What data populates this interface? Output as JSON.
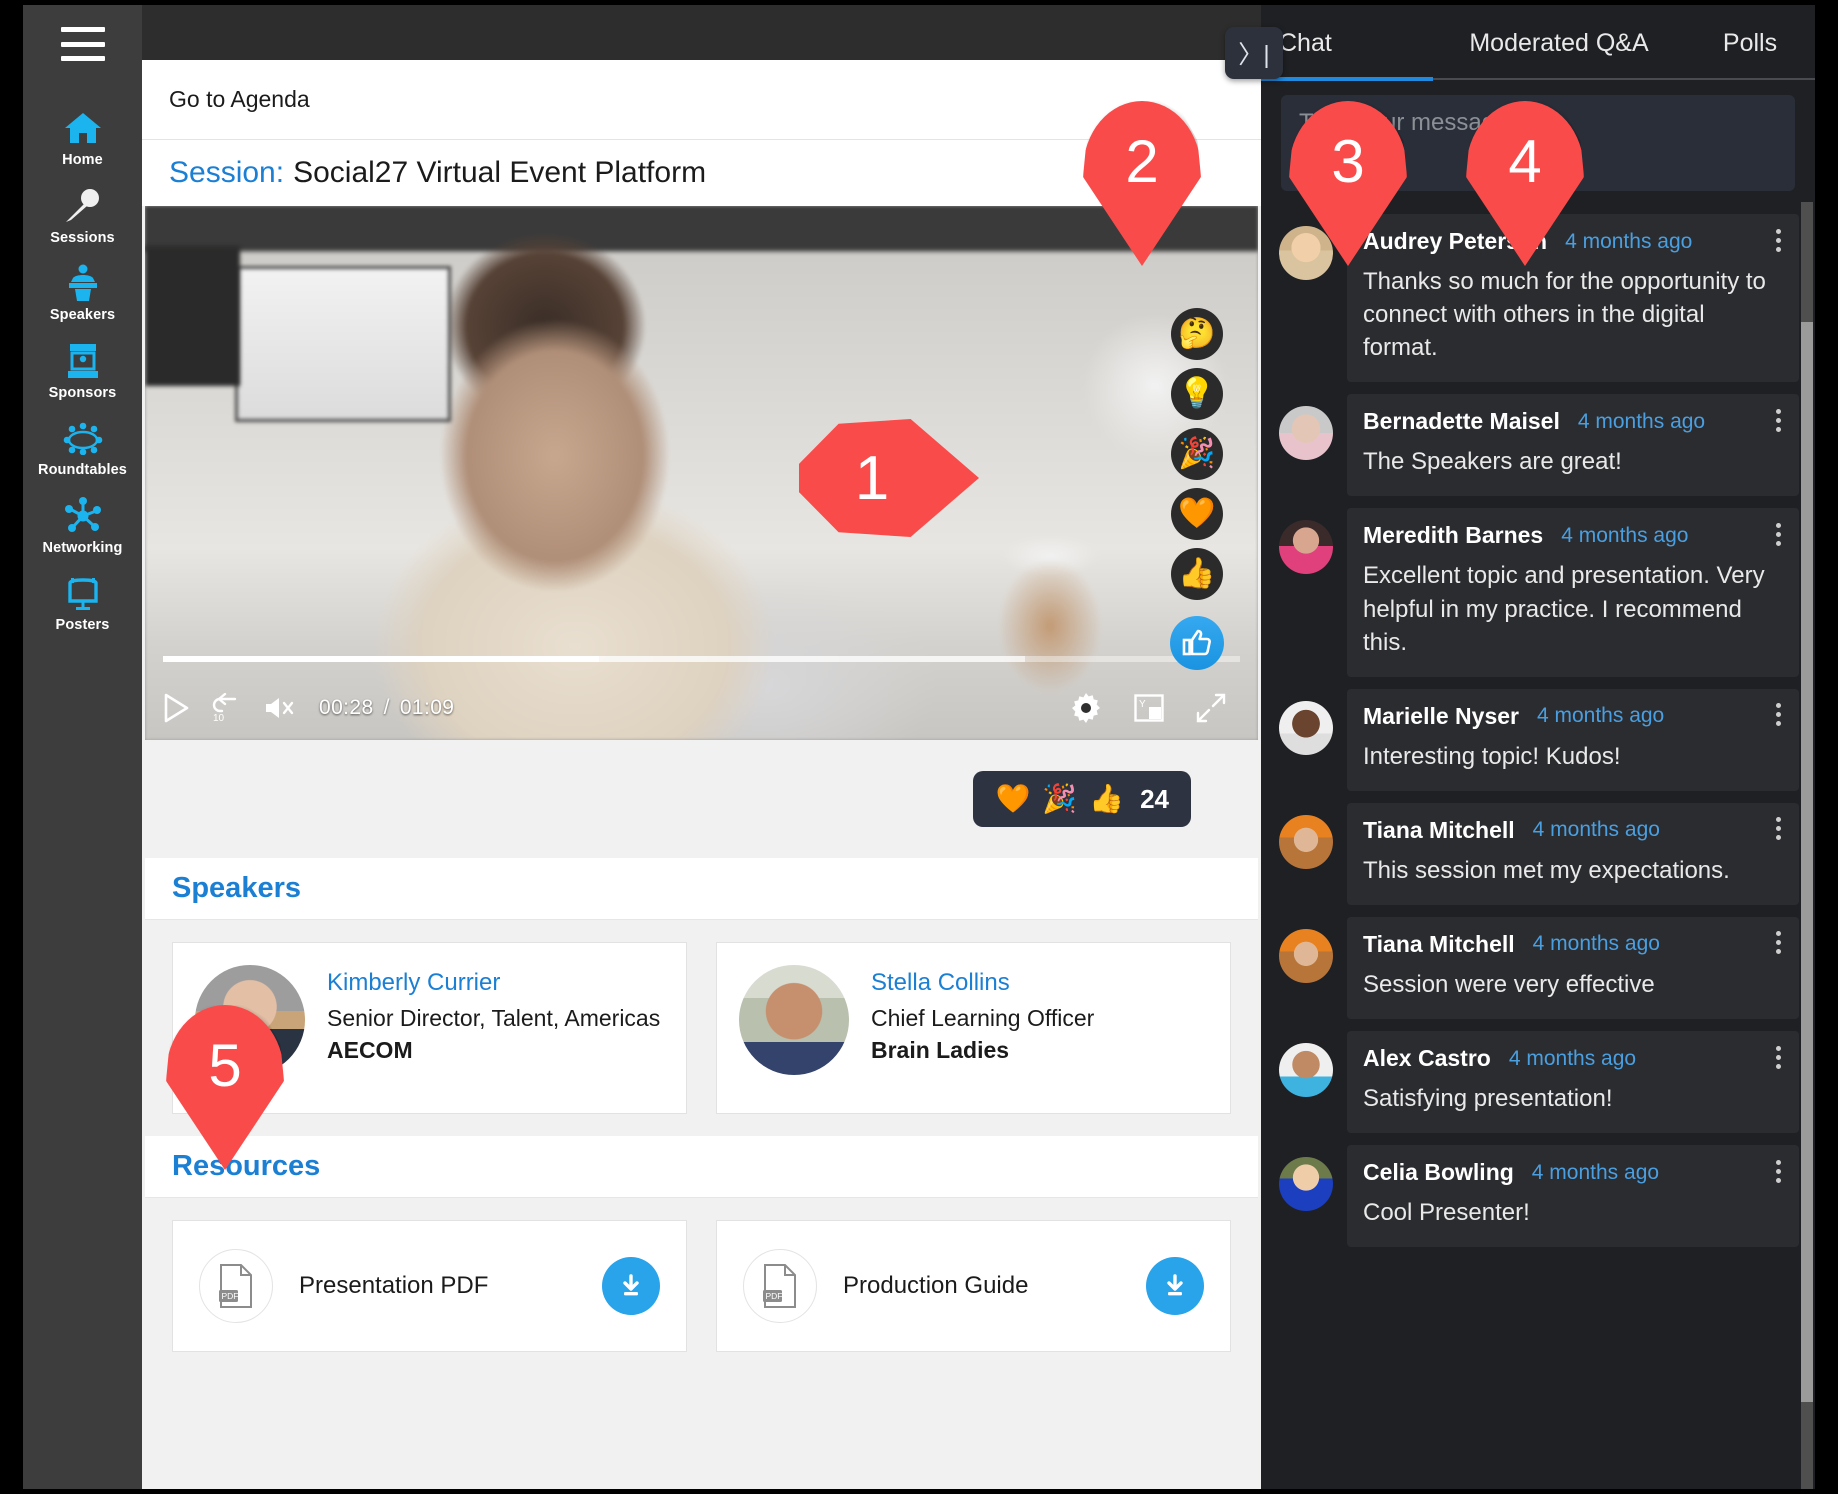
{
  "sidebar": {
    "menu_icon": "hamburger-menu-icon",
    "items": [
      {
        "label": "Home",
        "icon": "home-icon"
      },
      {
        "label": "Sessions",
        "icon": "microphone-icon"
      },
      {
        "label": "Speakers",
        "icon": "podium-speaker-icon"
      },
      {
        "label": "Sponsors",
        "icon": "booth-icon"
      },
      {
        "label": "Roundtables",
        "icon": "roundtable-icon"
      },
      {
        "label": "Networking",
        "icon": "network-nodes-icon"
      },
      {
        "label": "Posters",
        "icon": "poster-board-icon"
      }
    ]
  },
  "main": {
    "agenda_link": "Go to Agenda",
    "session_label": "Session:",
    "session_title": "Social27 Virtual Event Platform",
    "video": {
      "current_time": "00:28",
      "total_time": "01:09",
      "time_separator": "/",
      "play_icon": "play-icon",
      "rewind_icon": "rewind-10-icon",
      "rewind_label": "10",
      "mute_icon": "volume-muted-icon",
      "settings_icon": "gear-icon",
      "pip_icon": "picture-in-picture-icon",
      "fullscreen_icon": "fullscreen-icon",
      "progress_percent": 40.5,
      "buffered_percent": 80
    },
    "reactions": [
      {
        "icon": "thinking-face-icon",
        "glyph": "🤔"
      },
      {
        "icon": "lightbulb-icon",
        "glyph": "💡"
      },
      {
        "icon": "party-popper-icon",
        "glyph": "🎉"
      },
      {
        "icon": "orange-heart-icon",
        "glyph": "🧡"
      },
      {
        "icon": "thumbs-up-icon",
        "glyph": "👍"
      }
    ],
    "reaction_toggle_icon": "thumbs-up-outline-icon",
    "reaction_counter": {
      "emojis": [
        "🧡",
        "🎉",
        "👍"
      ],
      "count": "24"
    },
    "speakers_heading": "Speakers",
    "speakers": [
      {
        "name": "Kimberly Currier",
        "title": "Senior Director, Talent, Americas",
        "org": "AECOM",
        "avatar": "speaker-avatar"
      },
      {
        "name": "Stella Collins",
        "title": "Chief Learning Officer",
        "org": "Brain Ladies",
        "avatar": "speaker-avatar"
      }
    ],
    "resources_heading": "Resources",
    "resources": [
      {
        "name": "Presentation PDF",
        "file_icon": "pdf-file-icon",
        "download_icon": "download-icon"
      },
      {
        "name": "Production Guide",
        "file_icon": "pdf-file-icon",
        "download_icon": "download-icon"
      }
    ]
  },
  "chat": {
    "collapse_icon": "collapse-panel-icon",
    "collapse_glyph": "〉|",
    "tabs": [
      {
        "label": "Chat",
        "active": true
      },
      {
        "label": "Moderated Q&A",
        "active": false
      },
      {
        "label": "Polls",
        "active": false
      }
    ],
    "input_placeholder": "Type your message",
    "input_value": "",
    "messages": [
      {
        "name": "Audrey Peterson",
        "time": "4 months ago",
        "text": "Thanks so much for the opportunity to connect with others in the digital format."
      },
      {
        "name": "Bernadette Maisel",
        "time": "4 months ago",
        "text": "The Speakers are great!"
      },
      {
        "name": "Meredith Barnes",
        "time": "4 months ago",
        "text": "Excellent topic and presentation. Very helpful in my practice. I recommend this."
      },
      {
        "name": "Marielle Nyser",
        "time": "4 months ago",
        "text": "Interesting topic! Kudos!"
      },
      {
        "name": "Tiana Mitchell",
        "time": "4 months ago",
        "text": "This session met my expectations."
      },
      {
        "name": "Tiana Mitchell",
        "time": "4 months ago",
        "text": "Session were very effective"
      },
      {
        "name": "Alex Castro",
        "time": "4 months ago",
        "text": "Satisfying presentation!"
      },
      {
        "name": "Celia Bowling",
        "time": "4 months ago",
        "text": "Cool Presenter!"
      }
    ]
  },
  "markers": {
    "m1": "1",
    "m2": "2",
    "m3": "3",
    "m4": "4",
    "m5": "5"
  },
  "colors": {
    "accent_blue": "#1b7fd4",
    "marker_red": "#fa4b4b",
    "sidebar_bg": "#3d3d3d",
    "sidebar_icon": "#1bb4ef",
    "chat_bg": "#1f2024",
    "download_blue": "#29a3ea"
  }
}
